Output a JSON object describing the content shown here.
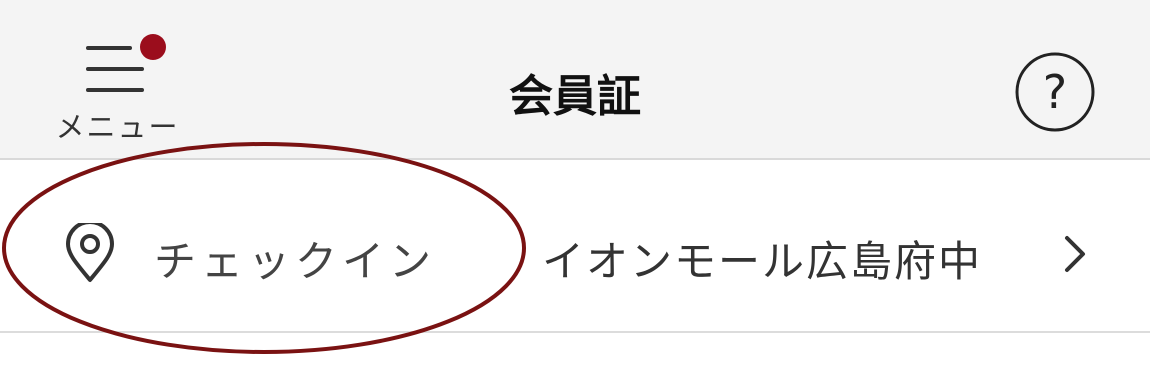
{
  "header": {
    "menu_label": "メニュー",
    "title": "会員証",
    "help_icon_glyph": "?"
  },
  "checkin_row": {
    "label": "チェックイン",
    "store_name": "イオンモール広島府中"
  },
  "icons": {
    "menu": "hamburger-menu-icon",
    "notification": "notification-badge",
    "help": "help-icon",
    "location": "location-pin-icon",
    "chevron": "chevron-right-icon"
  },
  "colors": {
    "badge": "#9b0d1c",
    "annotation_ellipse": "#7a1212",
    "header_bg": "#f4f4f4"
  }
}
